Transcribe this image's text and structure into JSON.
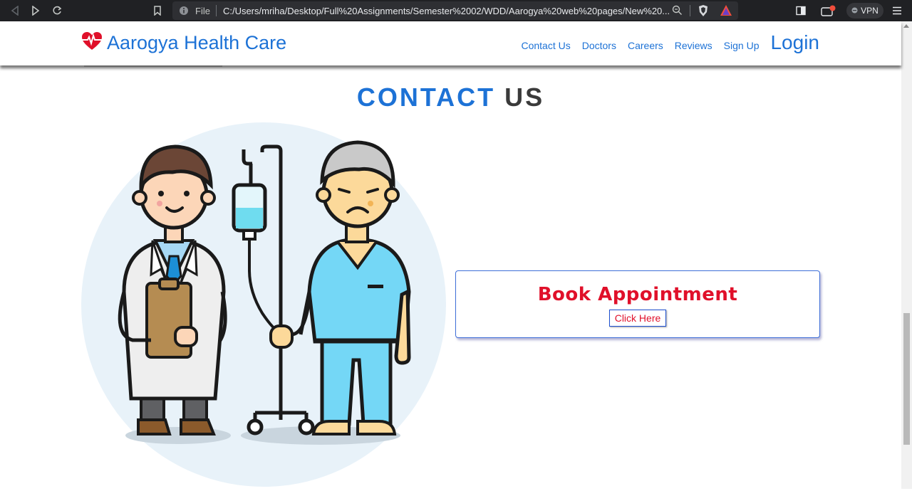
{
  "browser": {
    "file_label": "File",
    "url": "C:/Users/mriha/Desktop/Full%20Assignments/Semester%2002/WDD/Aarogya%20web%20pages/New%20...",
    "vpn_label": "VPN"
  },
  "header": {
    "brand": "Aarogya Health Care",
    "nav": [
      "Contact Us",
      "Doctors",
      "Careers",
      "Reviews",
      "Sign Up"
    ],
    "login": "Login"
  },
  "main": {
    "title_part1": "CONTACT",
    "title_part2": "US",
    "book": {
      "title": "Book Appointment",
      "button": "Click Here"
    }
  },
  "colors": {
    "brand_blue": "#1d72d6",
    "accent_red": "#e0102a",
    "title_dark": "#3a3a3a"
  }
}
